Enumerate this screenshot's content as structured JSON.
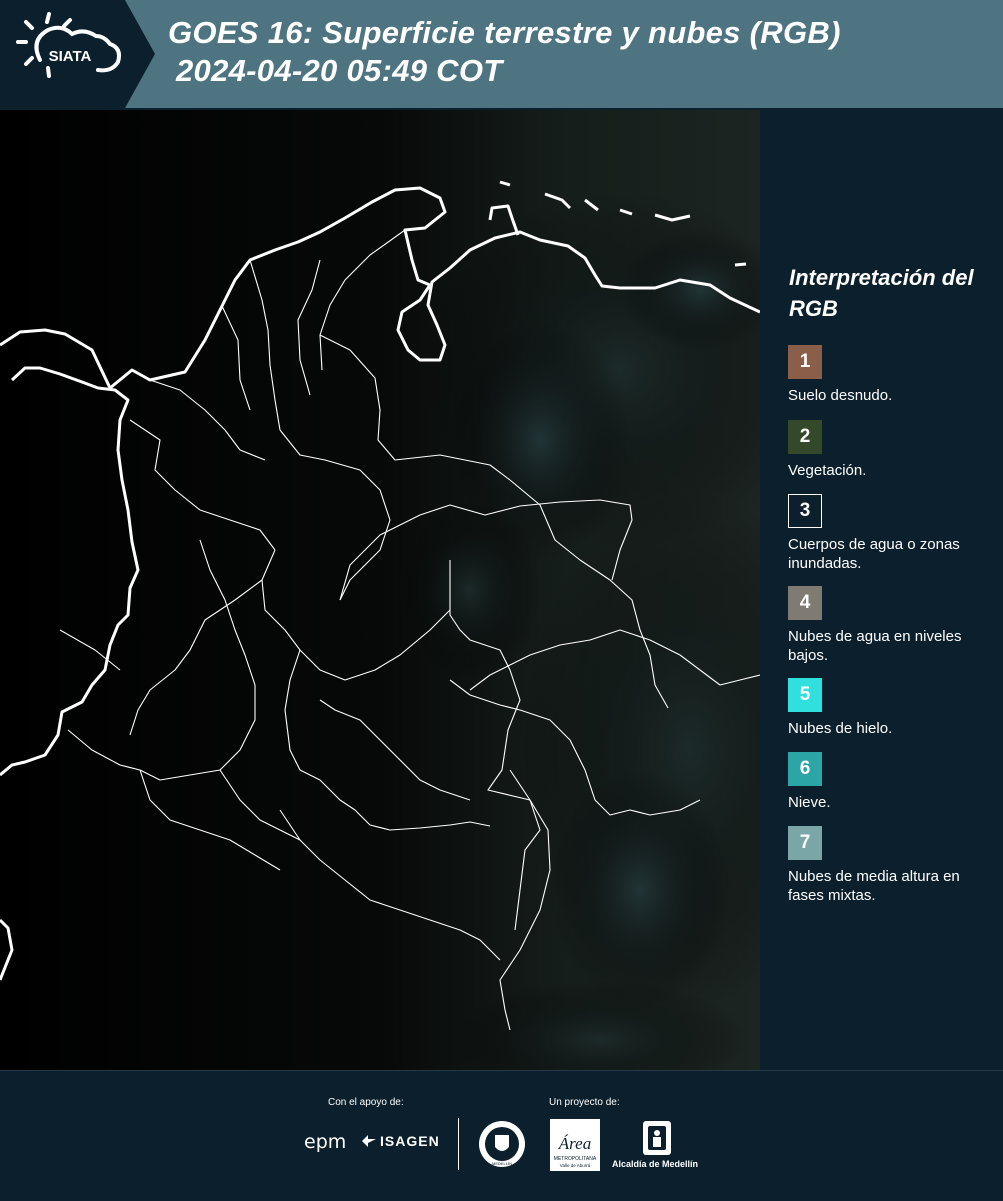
{
  "header": {
    "logo_text": "SIATA",
    "title_line1": "GOES 16: Superficie terrestre y nubes (RGB)",
    "title_line2": "2024-04-20 05:49 COT"
  },
  "legend": {
    "title": "Interpretación del RGB",
    "items": [
      {
        "number": "1",
        "label": "Suelo desnudo.",
        "color": "#8a5e48"
      },
      {
        "number": "2",
        "label": "Vegetación.",
        "color": "#34482a"
      },
      {
        "number": "3",
        "label": "Cuerpos de agua o zonas inundadas.",
        "color": "#0c1f2c"
      },
      {
        "number": "4",
        "label": "Nubes de agua en niveles bajos.",
        "color": "#7f7a72"
      },
      {
        "number": "5",
        "label": "Nubes de hielo.",
        "color": "#2fe0dc"
      },
      {
        "number": "6",
        "label": "Nieve.",
        "color": "#2ba5a5"
      },
      {
        "number": "7",
        "label": "Nubes de media altura en fases mixtas.",
        "color": "#7ba6a8"
      }
    ]
  },
  "footer": {
    "support_label": "Con el apoyo de:",
    "project_label": "Un proyecto de:",
    "epm_logo": "epm",
    "isagen_logo": "ISAGEN",
    "area_logo_text": "Área",
    "area_logo_sub": "METROPOLITANA",
    "area_logo_sub2": "Valle de Aburrá",
    "medellin_logo": "Alcaldía de Medellín",
    "seal_text": "MEDELLÍN"
  },
  "icons": {
    "sun_cloud": "sun-cloud-icon",
    "isagen_mark": "isagen-mark-icon",
    "seal": "seal-icon",
    "coat_of_arms": "coat-of-arms-icon"
  }
}
